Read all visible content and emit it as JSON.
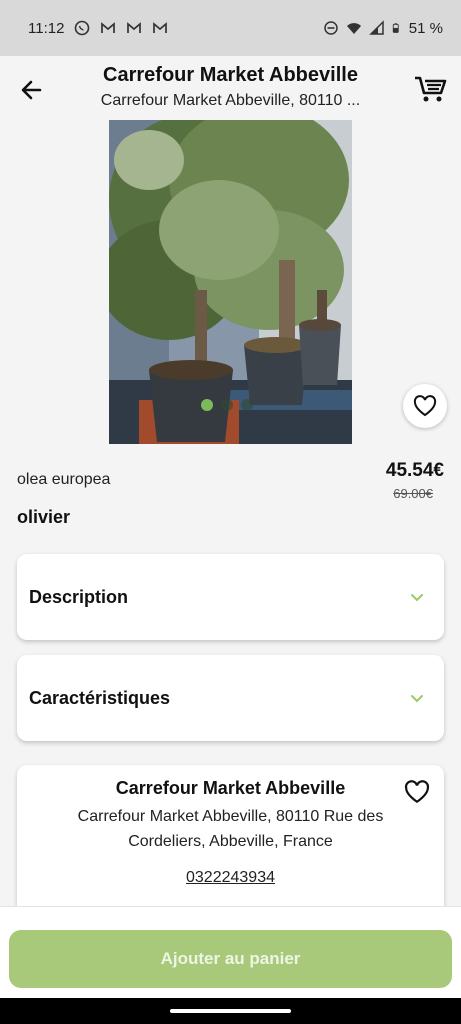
{
  "status_bar": {
    "time": "11:12",
    "notification_icons": [
      "whatsapp-icon",
      "gmail-icon",
      "gmail-icon",
      "gmail-icon"
    ],
    "battery": "51 %"
  },
  "header": {
    "title": "Carrefour Market Abbeville",
    "subtitle": "Carrefour Market Abbeville, 80110 ..."
  },
  "product": {
    "latin_name": "olea europea",
    "name": "olivier",
    "price": "45.54€",
    "old_price": "69.00€",
    "image_count": 3,
    "active_image": 1
  },
  "sections": {
    "description_label": "Description",
    "characteristics_label": "Caractéristiques"
  },
  "store": {
    "name": "Carrefour Market Abbeville",
    "address": "Carrefour Market Abbeville, 80110 Rue des Cordeliers, Abbeville, France",
    "phone": "0322243934"
  },
  "actions": {
    "add_to_cart_label": "Ajouter au panier"
  },
  "colors": {
    "accent_green": "#a8c97a",
    "chevron_green": "#9bc86b"
  }
}
